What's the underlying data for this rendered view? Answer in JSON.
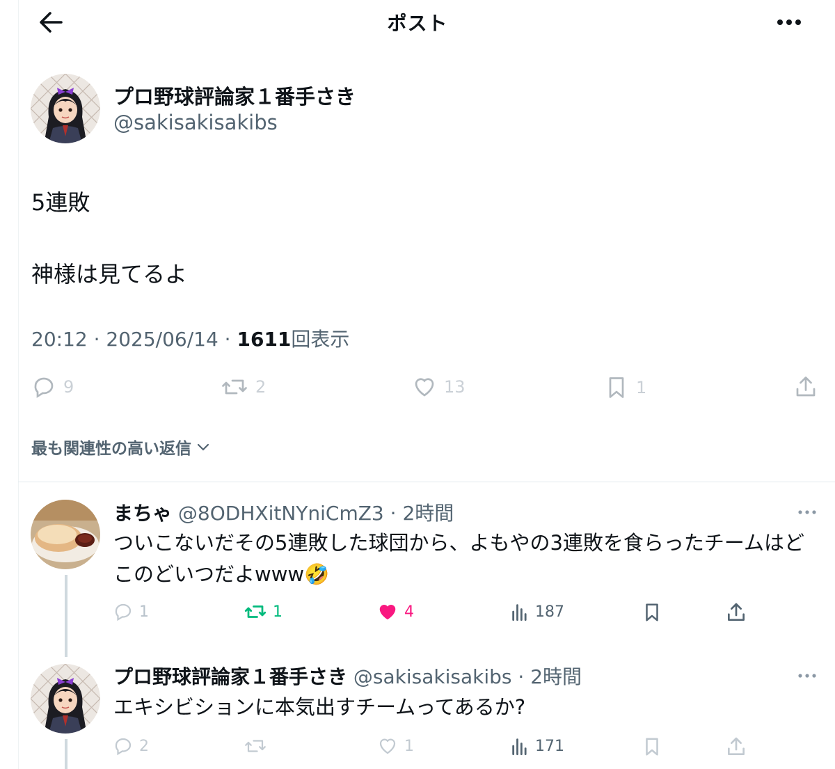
{
  "header": {
    "title": "ポスト"
  },
  "post": {
    "author_name": "プロ野球評論家１番手さき",
    "author_handle": "@sakisakisakibs",
    "lines": [
      "5連敗",
      "神様は見てるよ"
    ],
    "time": "20:12 · 2025/06/14 · ",
    "views": "1611",
    "views_label": "回表示",
    "actions": {
      "replies": "9",
      "reposts": "2",
      "likes": "13",
      "bookmarks": "1"
    }
  },
  "sort": {
    "label": "最も関連性の高い返信"
  },
  "replies": [
    {
      "name": "まちゃ",
      "handle": "@8ODHXitNYniCmZ3",
      "time": "· 2時間",
      "text": "ついこないだその5連敗した球団から、よもやの3連敗を食らったチームはどこのどいつだよwww🤣",
      "actions": {
        "replies": "1",
        "reposts": "1",
        "likes": "4",
        "views": "187"
      }
    },
    {
      "name": "プロ野球評論家１番手さき",
      "handle": "@sakisakisakibs",
      "time": "· 2時間",
      "text": "エキシビションに本気出すチームってあるか?",
      "actions": {
        "replies": "2",
        "reposts": "",
        "likes": "1",
        "views": "171"
      }
    }
  ],
  "colors": {
    "repost_active": "#00ba7c",
    "like_active": "#f91880",
    "secondary_text": "#536471"
  }
}
